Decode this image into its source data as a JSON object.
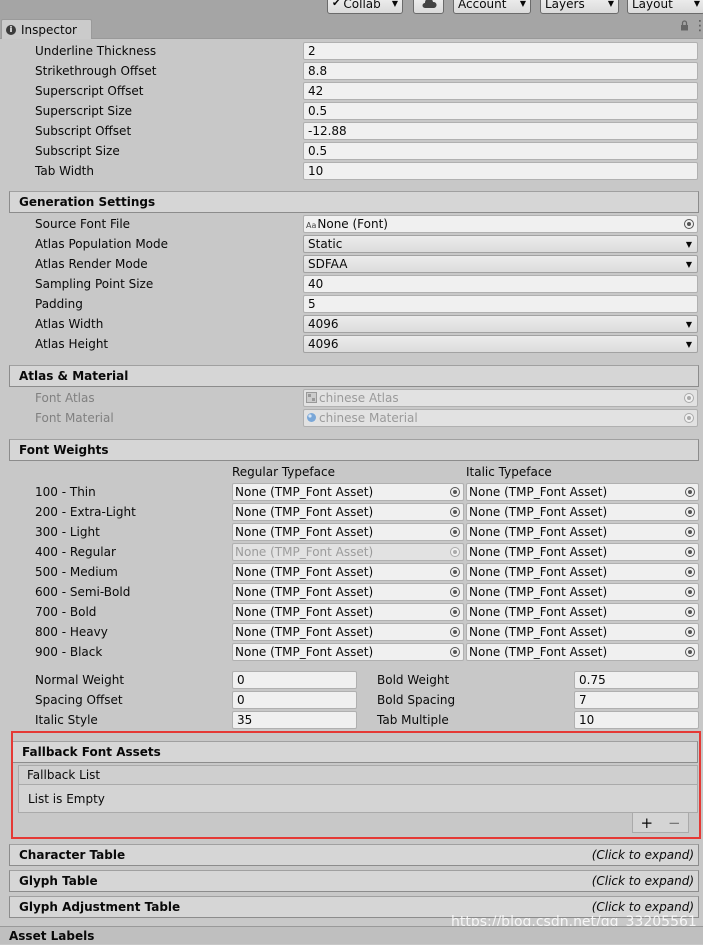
{
  "toolbar": {
    "collab": "Collab",
    "account": "Account",
    "layers": "Layers",
    "layout": "Layout"
  },
  "tab": {
    "title": "Inspector"
  },
  "font_settings": [
    {
      "label": "Underline Thickness",
      "value": "2"
    },
    {
      "label": "Strikethrough Offset",
      "value": "8.8"
    },
    {
      "label": "Superscript Offset",
      "value": "42"
    },
    {
      "label": "Superscript Size",
      "value": "0.5"
    },
    {
      "label": "Subscript Offset",
      "value": "-12.88"
    },
    {
      "label": "Subscript Size",
      "value": "0.5"
    },
    {
      "label": "Tab Width",
      "value": "10"
    }
  ],
  "generation": {
    "header": "Generation Settings",
    "source_font_file": {
      "label": "Source Font File",
      "value": "None (Font)"
    },
    "atlas_population_mode": {
      "label": "Atlas Population Mode",
      "value": "Static"
    },
    "atlas_render_mode": {
      "label": "Atlas Render Mode",
      "value": "SDFAA"
    },
    "sampling_point_size": {
      "label": "Sampling Point Size",
      "value": "40"
    },
    "padding": {
      "label": "Padding",
      "value": "5"
    },
    "atlas_width": {
      "label": "Atlas Width",
      "value": "4096"
    },
    "atlas_height": {
      "label": "Atlas Height",
      "value": "4096"
    }
  },
  "atlas_material": {
    "header": "Atlas & Material",
    "font_atlas": {
      "label": "Font Atlas",
      "value": "chinese Atlas"
    },
    "font_material": {
      "label": "Font Material",
      "value": "chinese Material"
    }
  },
  "font_weights": {
    "header": "Font Weights",
    "col_regular": "Regular Typeface",
    "col_italic": "Italic Typeface",
    "rows": [
      {
        "label": "100 - Thin",
        "regular": "None (TMP_Font Asset)",
        "italic": "None (TMP_Font Asset)"
      },
      {
        "label": "200 - Extra-Light",
        "regular": "None (TMP_Font Asset)",
        "italic": "None (TMP_Font Asset)"
      },
      {
        "label": "300 - Light",
        "regular": "None (TMP_Font Asset)",
        "italic": "None (TMP_Font Asset)"
      },
      {
        "label": "400 - Regular",
        "regular": "None (TMP_Font Asset)",
        "italic": "None (TMP_Font Asset)"
      },
      {
        "label": "500 - Medium",
        "regular": "None (TMP_Font Asset)",
        "italic": "None (TMP_Font Asset)"
      },
      {
        "label": "600 - Semi-Bold",
        "regular": "None (TMP_Font Asset)",
        "italic": "None (TMP_Font Asset)"
      },
      {
        "label": "700 - Bold",
        "regular": "None (TMP_Font Asset)",
        "italic": "None (TMP_Font Asset)"
      },
      {
        "label": "800 - Heavy",
        "regular": "None (TMP_Font Asset)",
        "italic": "None (TMP_Font Asset)"
      },
      {
        "label": "900 - Black",
        "regular": "None (TMP_Font Asset)",
        "italic": "None (TMP_Font Asset)"
      }
    ],
    "normal_weight": {
      "label": "Normal Weight",
      "value": "0"
    },
    "bold_weight": {
      "label": "Bold Weight",
      "value": "0.75"
    },
    "spacing_offset": {
      "label": "Spacing Offset",
      "value": "0"
    },
    "bold_spacing": {
      "label": "Bold Spacing",
      "value": "7"
    },
    "italic_style": {
      "label": "Italic Style",
      "value": "35"
    },
    "tab_multiple": {
      "label": "Tab Multiple",
      "value": "10"
    }
  },
  "fallback": {
    "header": "Fallback Font Assets",
    "list_header": "Fallback List",
    "empty_text": "List is Empty",
    "add": "+",
    "remove": "−"
  },
  "tables": [
    {
      "header": "Character Table",
      "hint": "(Click to expand)"
    },
    {
      "header": "Glyph Table",
      "hint": "(Click to expand)"
    },
    {
      "header": "Glyph Adjustment Table",
      "hint": "(Click to expand)"
    }
  ],
  "asset_labels": "Asset Labels",
  "watermark": "https://blog.csdn.net/qq_33205561",
  "colors": {
    "highlight": "#e53935"
  }
}
